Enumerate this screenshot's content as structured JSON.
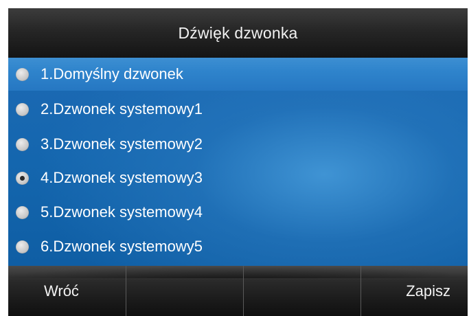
{
  "header": {
    "title": "Dźwięk dzwonka"
  },
  "ringtones": [
    {
      "label": "1.Domyślny dzwonek",
      "selected": true,
      "checked": false
    },
    {
      "label": "2.Dzwonek systemowy1",
      "selected": false,
      "checked": false
    },
    {
      "label": "3.Dzwonek systemowy2",
      "selected": false,
      "checked": false
    },
    {
      "label": "4.Dzwonek systemowy3",
      "selected": false,
      "checked": true
    },
    {
      "label": "5.Dzwonek systemowy4",
      "selected": false,
      "checked": false
    },
    {
      "label": "6.Dzwonek systemowy5",
      "selected": false,
      "checked": false
    }
  ],
  "softkeys": {
    "back_label": "Wróć",
    "key2_label": "",
    "key3_label": "",
    "save_label": "Zapisz"
  },
  "colors": {
    "list_blue": "#1466ae",
    "highlight_blue": "#2f84cc",
    "header_dark": "#262626"
  }
}
